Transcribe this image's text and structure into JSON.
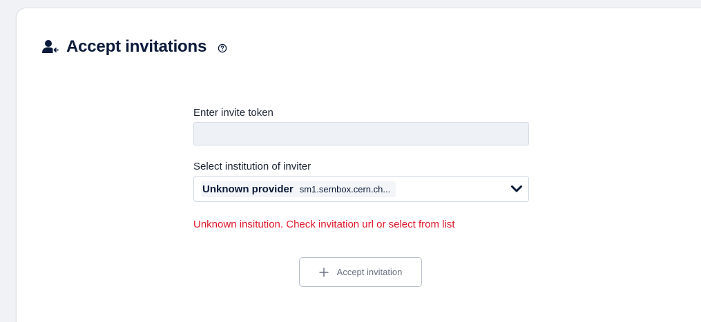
{
  "header": {
    "title": "Accept invitations",
    "title_icon": "user-accept-icon",
    "help_icon": "question-circle-icon"
  },
  "form": {
    "token_label": "Enter invite token",
    "token_value": "",
    "token_placeholder": "",
    "institution_label": "Select institution of inviter",
    "selected_provider_name": "Unknown provider",
    "selected_provider_domain": "sm1.sernbox.cern.ch...",
    "dropdown_icon": "chevron-down-icon",
    "error_message": "Unknown insitution. Check invitation url or select from list"
  },
  "actions": {
    "accept_label": "Accept invitation",
    "accept_icon": "plus-icon"
  },
  "colors": {
    "title": "#0b1a3a",
    "error": "#e0172a",
    "input_background": "#eef1f6",
    "button_text": "#6b7382"
  }
}
